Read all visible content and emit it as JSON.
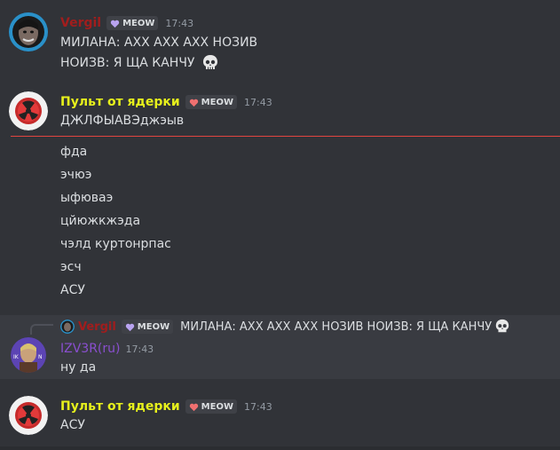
{
  "colors": {
    "background": "#313338",
    "vergil_name": "#a11d1d",
    "nuke_name": "#e6f01c",
    "izv_name": "#8a4fd0",
    "new_messages_divider": "#e2453f",
    "reply_highlight": "#393b41"
  },
  "messages": [
    {
      "username": "Vergil",
      "tag": "MEOW",
      "tag_icon": "purple-heart-icon",
      "time": "17:43",
      "lines": [
        "МИЛАНА: АХХ АХХ АХХ НОЗИВ",
        "НОИЗВ: Я ЩА КАНЧУ"
      ],
      "emoji": "skull-icon"
    },
    {
      "username": "Пульт от ядерки",
      "tag": "MEOW",
      "tag_icon": "red-heart-icon",
      "time": "17:43",
      "lines": [
        "ДЖЛФЫАВЭджэыв"
      ]
    },
    {
      "lines": [
        "фда",
        "эчюэ",
        "ыфювaэ",
        "цйюжкжэда",
        "чэлд куртонрпас",
        "эсч",
        "АСУ"
      ]
    },
    {
      "reply_to": {
        "username": "Vergil",
        "tag": "MEOW",
        "text": "МИЛАНА: АХХ АХХ АХХ НОЗИВ НОИЗВ: Я ЩА КАНЧУ"
      },
      "username": "IZV3R(ru)",
      "time": "17:43",
      "lines": [
        "ну да"
      ]
    },
    {
      "username": "Пульт от ядерки",
      "tag": "MEOW",
      "tag_icon": "red-heart-icon",
      "time": "17:43",
      "lines": [
        "АСУ"
      ]
    }
  ]
}
